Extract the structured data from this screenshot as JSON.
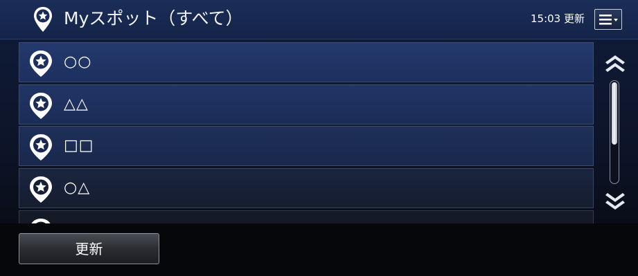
{
  "header": {
    "icon": "star-pin-icon",
    "title": "Myスポット（すべて）",
    "update_time": "15:03 更新",
    "menu_icon": "menu-dropdown-icon"
  },
  "list": {
    "items": [
      {
        "label": "○○",
        "icon": "star-pin-icon"
      },
      {
        "label": "△△",
        "icon": "star-pin-icon"
      },
      {
        "label": "□□",
        "icon": "star-pin-icon"
      },
      {
        "label": "○△",
        "icon": "star-pin-icon"
      },
      {
        "label": "",
        "icon": "star-pin-icon"
      }
    ]
  },
  "scrollbar": {
    "up_icon": "double-chevron-up-icon",
    "down_icon": "double-chevron-down-icon"
  },
  "footer": {
    "update_button_label": "更新"
  },
  "colors": {
    "header_bg": "#1b2e58",
    "list_item_bg": "#24396e",
    "footer_bg": "#06070a"
  }
}
